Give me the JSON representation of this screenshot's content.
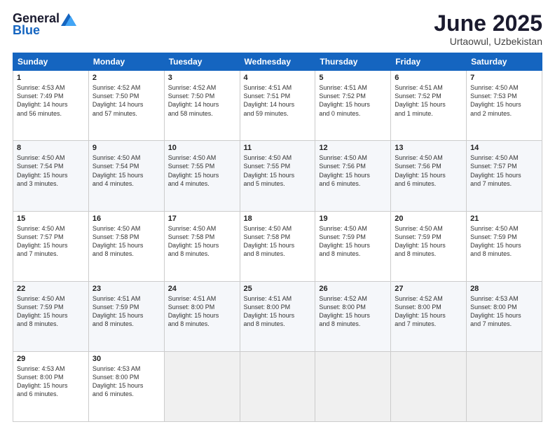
{
  "logo": {
    "general": "General",
    "blue": "Blue"
  },
  "header": {
    "month": "June 2025",
    "location": "Urtaowul, Uzbekistan"
  },
  "weekdays": [
    "Sunday",
    "Monday",
    "Tuesday",
    "Wednesday",
    "Thursday",
    "Friday",
    "Saturday"
  ],
  "weeks": [
    [
      {
        "day": "1",
        "info": "Sunrise: 4:53 AM\nSunset: 7:49 PM\nDaylight: 14 hours\nand 56 minutes."
      },
      {
        "day": "2",
        "info": "Sunrise: 4:52 AM\nSunset: 7:50 PM\nDaylight: 14 hours\nand 57 minutes."
      },
      {
        "day": "3",
        "info": "Sunrise: 4:52 AM\nSunset: 7:50 PM\nDaylight: 14 hours\nand 58 minutes."
      },
      {
        "day": "4",
        "info": "Sunrise: 4:51 AM\nSunset: 7:51 PM\nDaylight: 14 hours\nand 59 minutes."
      },
      {
        "day": "5",
        "info": "Sunrise: 4:51 AM\nSunset: 7:52 PM\nDaylight: 15 hours\nand 0 minutes."
      },
      {
        "day": "6",
        "info": "Sunrise: 4:51 AM\nSunset: 7:52 PM\nDaylight: 15 hours\nand 1 minute."
      },
      {
        "day": "7",
        "info": "Sunrise: 4:50 AM\nSunset: 7:53 PM\nDaylight: 15 hours\nand 2 minutes."
      }
    ],
    [
      {
        "day": "8",
        "info": "Sunrise: 4:50 AM\nSunset: 7:54 PM\nDaylight: 15 hours\nand 3 minutes."
      },
      {
        "day": "9",
        "info": "Sunrise: 4:50 AM\nSunset: 7:54 PM\nDaylight: 15 hours\nand 4 minutes."
      },
      {
        "day": "10",
        "info": "Sunrise: 4:50 AM\nSunset: 7:55 PM\nDaylight: 15 hours\nand 4 minutes."
      },
      {
        "day": "11",
        "info": "Sunrise: 4:50 AM\nSunset: 7:55 PM\nDaylight: 15 hours\nand 5 minutes."
      },
      {
        "day": "12",
        "info": "Sunrise: 4:50 AM\nSunset: 7:56 PM\nDaylight: 15 hours\nand 6 minutes."
      },
      {
        "day": "13",
        "info": "Sunrise: 4:50 AM\nSunset: 7:56 PM\nDaylight: 15 hours\nand 6 minutes."
      },
      {
        "day": "14",
        "info": "Sunrise: 4:50 AM\nSunset: 7:57 PM\nDaylight: 15 hours\nand 7 minutes."
      }
    ],
    [
      {
        "day": "15",
        "info": "Sunrise: 4:50 AM\nSunset: 7:57 PM\nDaylight: 15 hours\nand 7 minutes."
      },
      {
        "day": "16",
        "info": "Sunrise: 4:50 AM\nSunset: 7:58 PM\nDaylight: 15 hours\nand 8 minutes."
      },
      {
        "day": "17",
        "info": "Sunrise: 4:50 AM\nSunset: 7:58 PM\nDaylight: 15 hours\nand 8 minutes."
      },
      {
        "day": "18",
        "info": "Sunrise: 4:50 AM\nSunset: 7:58 PM\nDaylight: 15 hours\nand 8 minutes."
      },
      {
        "day": "19",
        "info": "Sunrise: 4:50 AM\nSunset: 7:59 PM\nDaylight: 15 hours\nand 8 minutes."
      },
      {
        "day": "20",
        "info": "Sunrise: 4:50 AM\nSunset: 7:59 PM\nDaylight: 15 hours\nand 8 minutes."
      },
      {
        "day": "21",
        "info": "Sunrise: 4:50 AM\nSunset: 7:59 PM\nDaylight: 15 hours\nand 8 minutes."
      }
    ],
    [
      {
        "day": "22",
        "info": "Sunrise: 4:50 AM\nSunset: 7:59 PM\nDaylight: 15 hours\nand 8 minutes."
      },
      {
        "day": "23",
        "info": "Sunrise: 4:51 AM\nSunset: 7:59 PM\nDaylight: 15 hours\nand 8 minutes."
      },
      {
        "day": "24",
        "info": "Sunrise: 4:51 AM\nSunset: 8:00 PM\nDaylight: 15 hours\nand 8 minutes."
      },
      {
        "day": "25",
        "info": "Sunrise: 4:51 AM\nSunset: 8:00 PM\nDaylight: 15 hours\nand 8 minutes."
      },
      {
        "day": "26",
        "info": "Sunrise: 4:52 AM\nSunset: 8:00 PM\nDaylight: 15 hours\nand 8 minutes."
      },
      {
        "day": "27",
        "info": "Sunrise: 4:52 AM\nSunset: 8:00 PM\nDaylight: 15 hours\nand 7 minutes."
      },
      {
        "day": "28",
        "info": "Sunrise: 4:53 AM\nSunset: 8:00 PM\nDaylight: 15 hours\nand 7 minutes."
      }
    ],
    [
      {
        "day": "29",
        "info": "Sunrise: 4:53 AM\nSunset: 8:00 PM\nDaylight: 15 hours\nand 6 minutes."
      },
      {
        "day": "30",
        "info": "Sunrise: 4:53 AM\nSunset: 8:00 PM\nDaylight: 15 hours\nand 6 minutes."
      },
      {
        "day": "",
        "info": ""
      },
      {
        "day": "",
        "info": ""
      },
      {
        "day": "",
        "info": ""
      },
      {
        "day": "",
        "info": ""
      },
      {
        "day": "",
        "info": ""
      }
    ]
  ]
}
